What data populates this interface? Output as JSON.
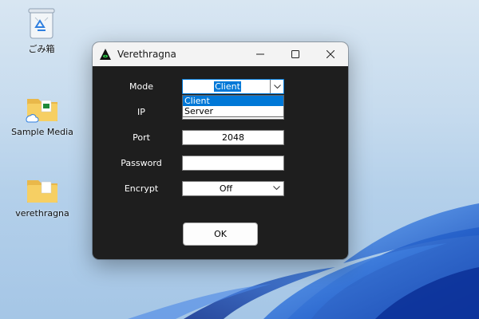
{
  "desktop": {
    "icons": [
      {
        "label": "ごみ箱",
        "icon": "recycle-bin-icon"
      },
      {
        "label": "Sample Media",
        "icon": "folder-icon"
      },
      {
        "label": "verethragna",
        "icon": "folder-icon"
      }
    ]
  },
  "window": {
    "title": "Verethragna",
    "app_icon": "triangle-eye-icon",
    "caption": {
      "minimize": "minimize-icon",
      "maximize": "maximize-icon",
      "close": "close-icon"
    }
  },
  "form": {
    "mode": {
      "label": "Mode",
      "value": "Client",
      "options": [
        "Client",
        "Server"
      ],
      "highlighted_option": "Client"
    },
    "ip": {
      "label": "IP",
      "value": ""
    },
    "port": {
      "label": "Port",
      "value": "2048"
    },
    "password": {
      "label": "Password",
      "value": ""
    },
    "encrypt": {
      "label": "Encrypt",
      "value": "Off"
    },
    "ok_label": "OK"
  },
  "colors": {
    "window_bg": "#1e1e1e",
    "titlebar_bg": "#f3f3f3",
    "accent": "#0078d7"
  }
}
